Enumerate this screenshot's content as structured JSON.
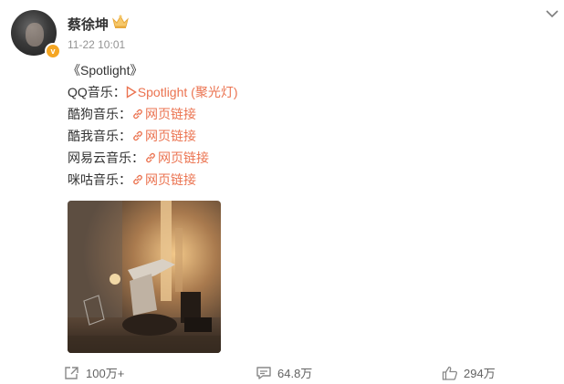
{
  "post": {
    "author": "蔡徐坤",
    "timestamp": "11-22 10:01",
    "lines": {
      "title": "《Spotlight》",
      "qq_label": "QQ音乐：",
      "qq_link": "Spotlight (聚光灯)",
      "kugou_label": "酷狗音乐：",
      "kugou_link": "网页链接",
      "kuwo_label": "酷我音乐：",
      "kuwo_link": "网页链接",
      "netease_label": "网易云音乐：",
      "netease_link": "网页链接",
      "migu_label": "咪咕音乐：",
      "migu_link": "网页链接"
    },
    "icons": {
      "verified": "verified-v-icon",
      "member": "crown-icon",
      "more": "chevron-down-icon",
      "play": "play-icon",
      "link": "link-icon"
    }
  },
  "actions": {
    "share_count": "100万+",
    "comment_count": "64.8万",
    "like_count": "294万"
  },
  "colors": {
    "link": "#eb7350",
    "verified": "#f5a623",
    "timestamp": "#939393"
  }
}
